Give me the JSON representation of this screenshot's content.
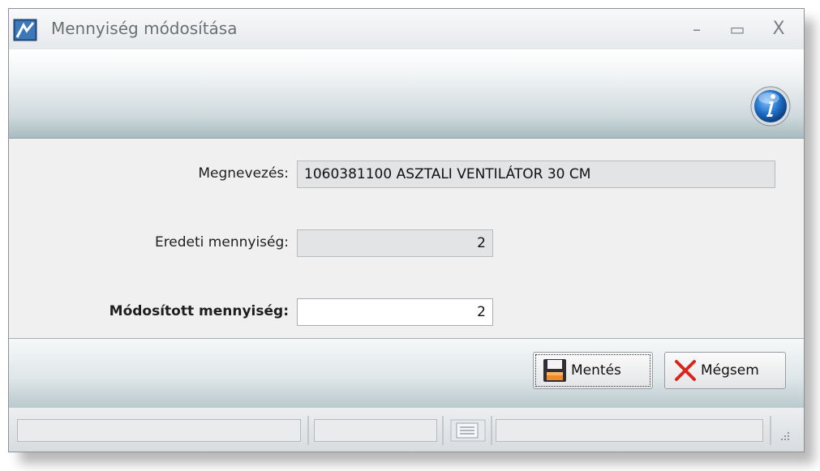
{
  "window": {
    "title": "Mennyiség módosítása",
    "minimize_glyph": "–",
    "maximize_glyph": "▭",
    "close_glyph": "X"
  },
  "form": {
    "name_label": "Megnevezés:",
    "name_value": "1060381100 ASZTALI VENTILÁTOR 30 CM",
    "original_qty_label": "Eredeti mennyiség:",
    "original_qty_value": "2",
    "modified_qty_label": "Módosított mennyiség:",
    "modified_qty_value": "2"
  },
  "buttons": {
    "save_label": "Mentés",
    "cancel_label": "Mégsem"
  },
  "icons": [
    "app-icon",
    "info-icon",
    "save-icon",
    "cancel-icon",
    "status-panel-icon",
    "resize-grip-icon"
  ],
  "colors": {
    "header_band": "#cfdadd",
    "cancel_x": "#d8261c",
    "info_blue": "#1f6fc7"
  }
}
